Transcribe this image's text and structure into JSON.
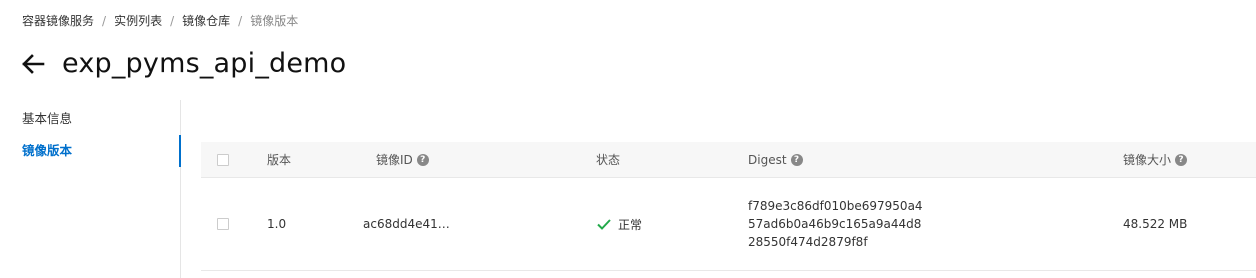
{
  "breadcrumb": [
    "容器镜像服务",
    "实例列表",
    "镜像仓库",
    "镜像版本"
  ],
  "breadcrumb_sep": "/",
  "title": "exp_pyms_api_demo",
  "sidebar": {
    "items": [
      {
        "label": "基本信息",
        "active": false
      },
      {
        "label": "镜像版本",
        "active": true
      }
    ]
  },
  "table": {
    "headers": {
      "version": "版本",
      "image_id": "镜像ID",
      "status": "状态",
      "digest": "Digest",
      "size": "镜像大小"
    },
    "rows": [
      {
        "version": "1.0",
        "image_id": "ac68dd4e41…",
        "status": "正常",
        "digest_lines": [
          "f789e3c86df010be697950a4",
          "57ad6b0a46b9c165a9a44d8",
          "28550f474d2879f8f"
        ],
        "size": "48.522 MB"
      }
    ]
  },
  "colors": {
    "accent": "#0070cc",
    "success": "#22a94a",
    "help_icon": "#888888"
  },
  "icons": {
    "back": "arrow-left-icon",
    "help": "question-circle-icon",
    "status_ok": "check-icon"
  }
}
